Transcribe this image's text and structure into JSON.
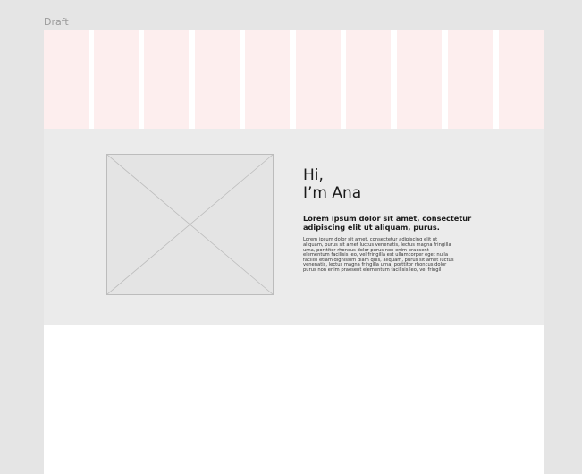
{
  "canvas": {
    "frame_label": "Draft",
    "background": "#e5e5e5",
    "frame_background": "#ffffff"
  },
  "layout_grid": {
    "columns": 10,
    "column_color": "#fdeeee"
  },
  "hero": {
    "background": "#ebebeb",
    "image_placeholder": "image-placeholder-icon",
    "greeting_line1": "Hi,",
    "greeting_line2": "I’m Ana",
    "lead": "Lorem ipsum dolor sit amet, consectetur adipiscing elit ut aliquam, purus.",
    "body": "Lorem ipsum dolor sit amet, consectetur adipiscing elit ut aliquam, purus sit amet luctus venenatis, lectus magna fringilla urna, porttitor rhoncus dolor purus non enim praesent elementum facilisis leo, vel fringilla est ullamcorper eget nulla facilisi etiam dignissim diam quis, aliquam, purus sit amet luctus venenatis, lectus magna fringilla urna, porttitor rhoncus dolor purus non enim praesent elementum facilisis leo, vel fringil"
  }
}
